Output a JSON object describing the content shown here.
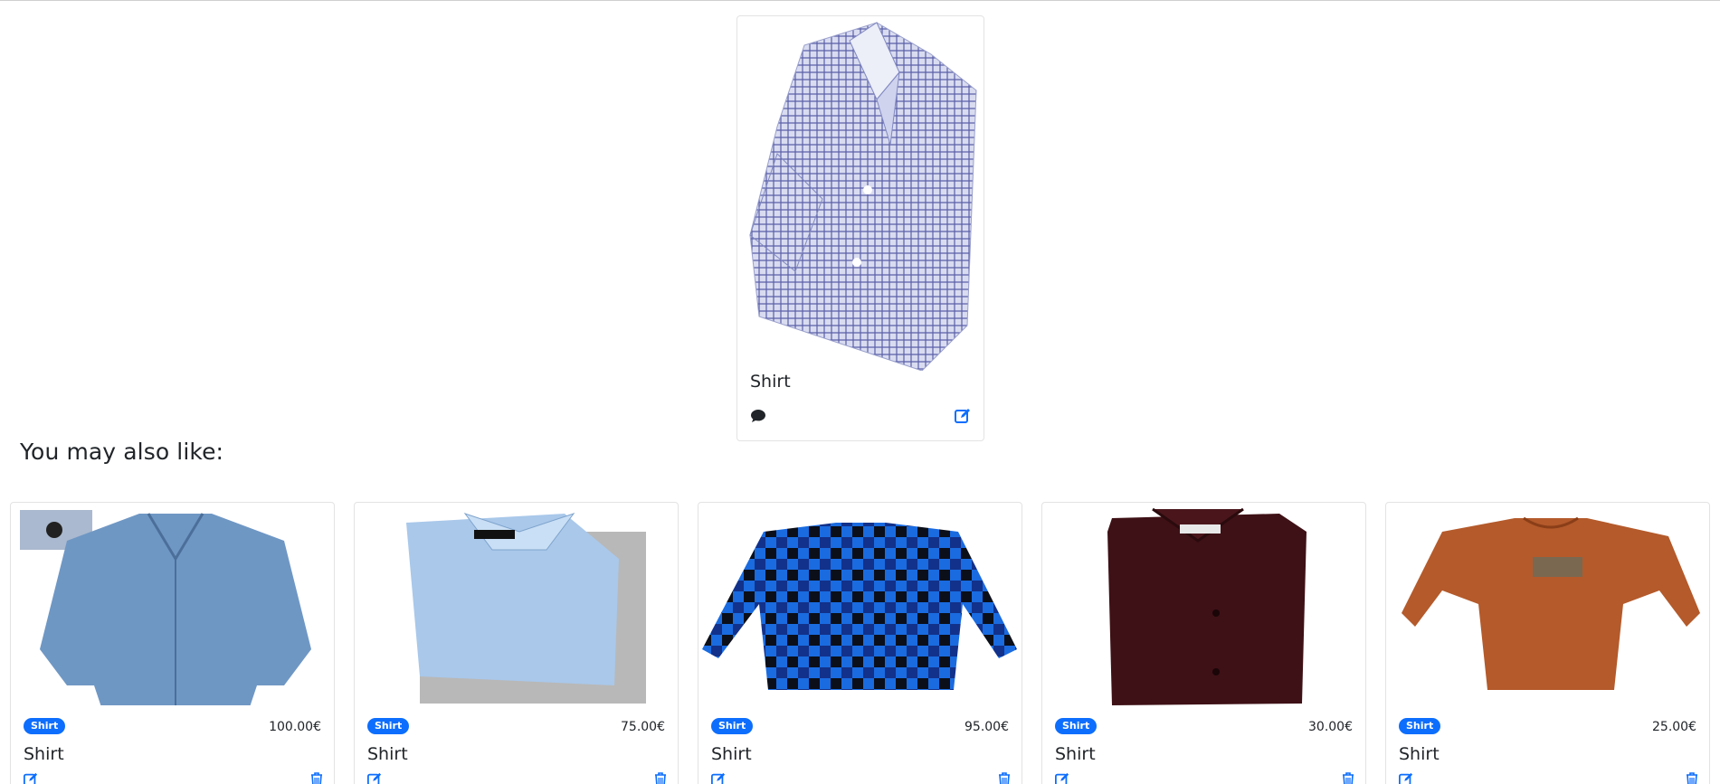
{
  "featured": {
    "title": "Shirt",
    "image_icon": "checked-shirt-image",
    "actions": [
      "comment-icon",
      "edit-icon"
    ],
    "colors": {
      "accent": "#0d6efd"
    }
  },
  "section": {
    "title": "You may also like:"
  },
  "products": [
    {
      "badge": "Shirt",
      "price": "100.00€",
      "name": "Shirt",
      "image": "denim-shirt-image"
    },
    {
      "badge": "Shirt",
      "price": "75.00€",
      "name": "Shirt",
      "image": "light-blue-folded-shirt-image"
    },
    {
      "badge": "Shirt",
      "price": "95.00€",
      "name": "Shirt",
      "image": "blue-plaid-shirt-image"
    },
    {
      "badge": "Shirt",
      "price": "30.00€",
      "name": "Shirt",
      "image": "burgundy-folded-shirt-image"
    },
    {
      "badge": "Shirt",
      "price": "25.00€",
      "name": "Shirt",
      "image": "orange-longsleeve-shirt-image"
    }
  ]
}
